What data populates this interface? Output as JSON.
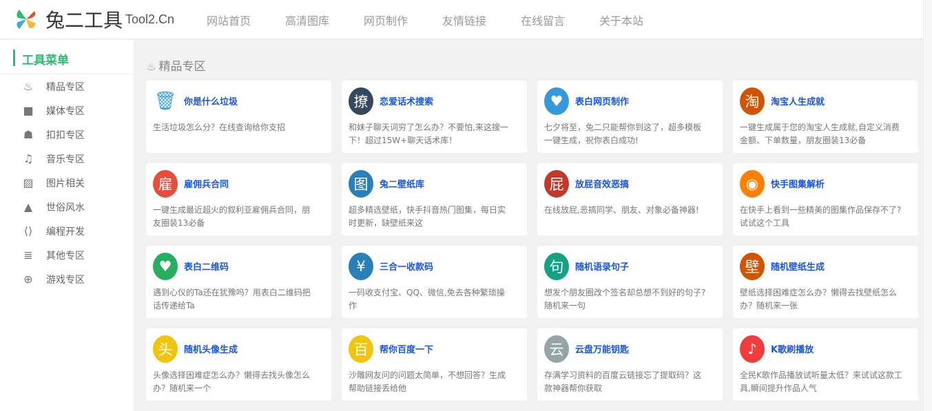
{
  "header": {
    "logo_text": "兔二工具",
    "logo_sub": "Tool2.Cn",
    "nav": [
      "网站首页",
      "高清图库",
      "网页制作",
      "友情链接",
      "在线留言",
      "关于本站"
    ]
  },
  "sidebar": {
    "title": "工具菜单",
    "items": [
      {
        "label": "精品专区",
        "icon": "fire-icon",
        "glyph": "♨"
      },
      {
        "label": "媒体专区",
        "icon": "video-icon",
        "glyph": "■"
      },
      {
        "label": "扣扣专区",
        "icon": "qq-icon",
        "glyph": "☗"
      },
      {
        "label": "音乐专区",
        "icon": "music-icon",
        "glyph": "♫"
      },
      {
        "label": "图片相关",
        "icon": "image-icon",
        "glyph": "▨"
      },
      {
        "label": "世俗风水",
        "icon": "tree-icon",
        "glyph": "▲"
      },
      {
        "label": "编程开发",
        "icon": "code-file-icon",
        "glyph": "⟨⟩"
      },
      {
        "label": "其他专区",
        "icon": "database-icon",
        "glyph": "≣"
      },
      {
        "label": "游戏专区",
        "icon": "gamepad-icon",
        "glyph": "⊕"
      }
    ]
  },
  "section": {
    "title": "精品专区",
    "icon": "fire-icon"
  },
  "colors": {
    "accent": "#2dba73",
    "title": "#1b55d8"
  },
  "cards": [
    {
      "title": "你是什么垃圾",
      "desc": "生活垃圾怎么分？在线查询给你支招",
      "glyph": "🗑",
      "color": "#ffffff",
      "icon": "trash-icon"
    },
    {
      "title": "恋爱话术搜索",
      "desc": "和妹子聊天词穷了怎么办？不要怕,来这搜一下！超过15W+聊天话术库！",
      "glyph": "撩",
      "color": "#34495e",
      "icon": "liao-icon"
    },
    {
      "title": "表白网页制作",
      "desc": "七夕将至，兔二只能帮你到这了，超多模板一键生成，祝你表白成功!",
      "glyph": "♥",
      "color": "#3498db",
      "icon": "heart-icon"
    },
    {
      "title": "淘宝人生成就",
      "desc": "一键生成属于您的淘宝人生成就,自定义消费金额、下单数量，朋友圈装13必备",
      "glyph": "淘",
      "color": "#d35400",
      "icon": "taobao-icon"
    },
    {
      "title": "雇佣兵合同",
      "desc": "一键生成最近超火的叙利亚雇佣兵合同，朋友圈装13必备",
      "glyph": "雇",
      "color": "#e74c3c",
      "icon": "gu-icon"
    },
    {
      "title": "兔二壁纸库",
      "desc": "超多精选壁纸，快手抖音热门图集，每日实时更新，缺壁纸来这",
      "glyph": "图",
      "color": "#2980b9",
      "icon": "tu-icon"
    },
    {
      "title": "放屁音效恶搞",
      "desc": "在线放屁,恶搞同学、朋友、对象必备神器!",
      "glyph": "屁",
      "color": "#c0392b",
      "icon": "pi-icon"
    },
    {
      "title": "快手图集解析",
      "desc": "在快手上看到一些精美的图集作品保存不了?试试这个工具",
      "glyph": "◉",
      "color": "#ff8000",
      "icon": "kuaishou-icon"
    },
    {
      "title": "表白二维码",
      "desc": "遇到心仪的Ta还在犹豫吗？用表白二维码把话传递给Ta",
      "glyph": "♥",
      "color": "#27ae60",
      "icon": "heart-icon"
    },
    {
      "title": "三合一收款码",
      "desc": "一码收支付宝、QQ、微信,免去各种繁琐操作",
      "glyph": "¥",
      "color": "#2980b9",
      "icon": "yuan-icon"
    },
    {
      "title": "随机语录句子",
      "desc": "想发个朋友圈改个签名却总想不到好的句子?随机来一句",
      "glyph": "句",
      "color": "#16a085",
      "icon": "ju-icon"
    },
    {
      "title": "随机壁纸生成",
      "desc": "壁纸选择困难症怎么办？懒得去找壁纸怎么办？随机来一张",
      "glyph": "壁",
      "color": "#d35400",
      "icon": "bi-icon"
    },
    {
      "title": "随机头像生成",
      "desc": "头像选择困难症怎么办？懒得去找头像怎么办？随机来一个",
      "glyph": "头",
      "color": "#f1c40f",
      "icon": "tou-icon"
    },
    {
      "title": "帮你百度一下",
      "desc": "沙雕网友问的问题太简单，不想回答？生成帮助链接丢给他",
      "glyph": "百",
      "color": "#f1c40f",
      "icon": "bai-icon"
    },
    {
      "title": "云盘万能钥匙",
      "desc": "存满学习资料的百度云链接忘了提取码？这款神器帮你获取",
      "glyph": "云",
      "color": "#95a5a6",
      "icon": "yun-icon"
    },
    {
      "title": "K歌刷播放",
      "desc": "全民K歌作品播放试听量太低？来试试这款工具,瞬间提升作品人气",
      "glyph": "♪",
      "color": "#f03c3c",
      "icon": "kge-icon"
    }
  ]
}
